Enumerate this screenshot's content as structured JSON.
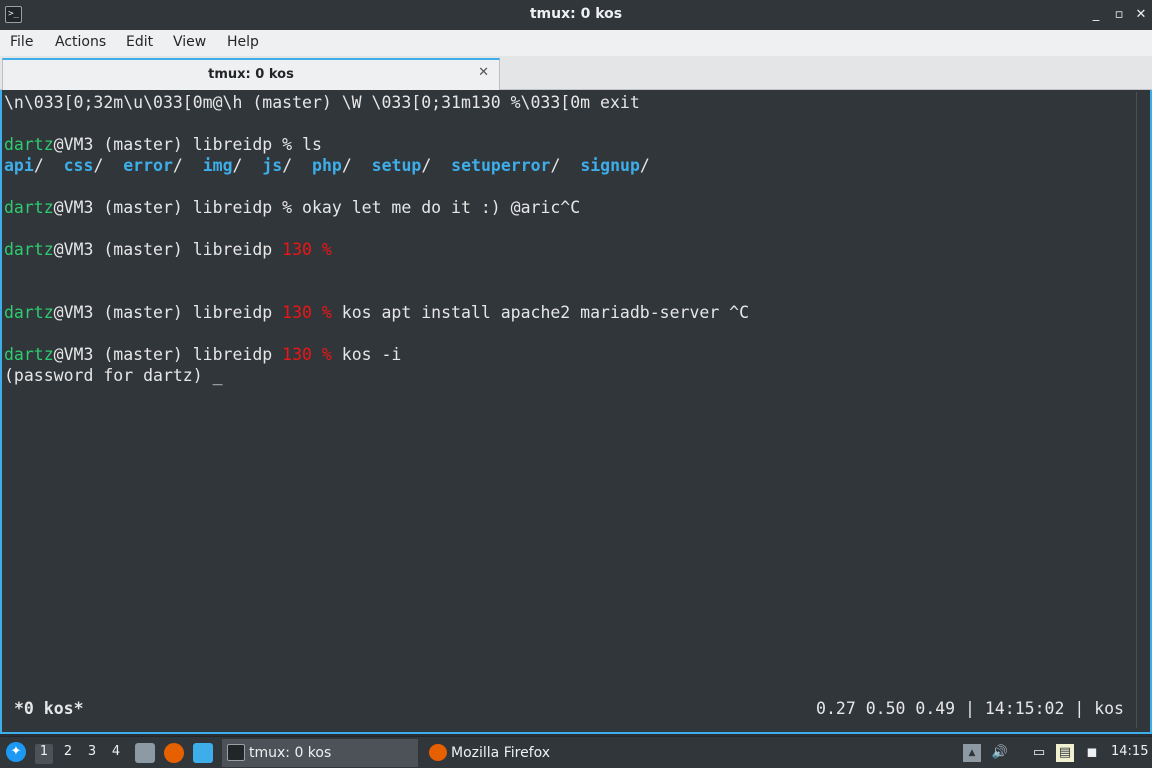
{
  "window": {
    "title": "tmux: 0 kos",
    "icon": "terminal-icon",
    "buttons": {
      "minimize": "_",
      "maximize": "▫",
      "close": "✕"
    }
  },
  "menu": [
    "File",
    "Actions",
    "Edit",
    "View",
    "Help"
  ],
  "tab": {
    "label": "tmux: 0 kos",
    "close": "✕"
  },
  "terminal": {
    "line1": "\\n\\033[0;32m\\u\\033[0m@\\h (master) \\W \\033[0;31m130 %\\033[0m exit",
    "user": "dartz",
    "host_path": "@VM3 (master) libreidp ",
    "prompt_plain": "% ",
    "prompt_red": "130 % ",
    "cmd_ls": "ls",
    "dirs": [
      "api",
      "css",
      "error",
      "img",
      "js",
      "php",
      "setup",
      "setuperror",
      "signup"
    ],
    "cmd_okay": "okay let me do it :) @aric^C",
    "cmd_kos_apt": "kos apt install apache2 mariadb-server ^C",
    "cmd_kos_i": "kos -i",
    "password_prompt": "(password for dartz) ",
    "cursor": "_"
  },
  "tmux_status": {
    "left": "*0 kos*",
    "right": "0.27 0.50 0.49 | 14:15:02 | kos"
  },
  "taskbar": {
    "workspaces": [
      "1",
      "2",
      "3",
      "4"
    ],
    "active_workspace": "1",
    "tasks": [
      {
        "label": "tmux: 0 kos",
        "icon": "terminal-icon"
      },
      {
        "label": "Mozilla Firefox",
        "icon": "firefox-icon"
      }
    ],
    "clock": "14:15"
  }
}
